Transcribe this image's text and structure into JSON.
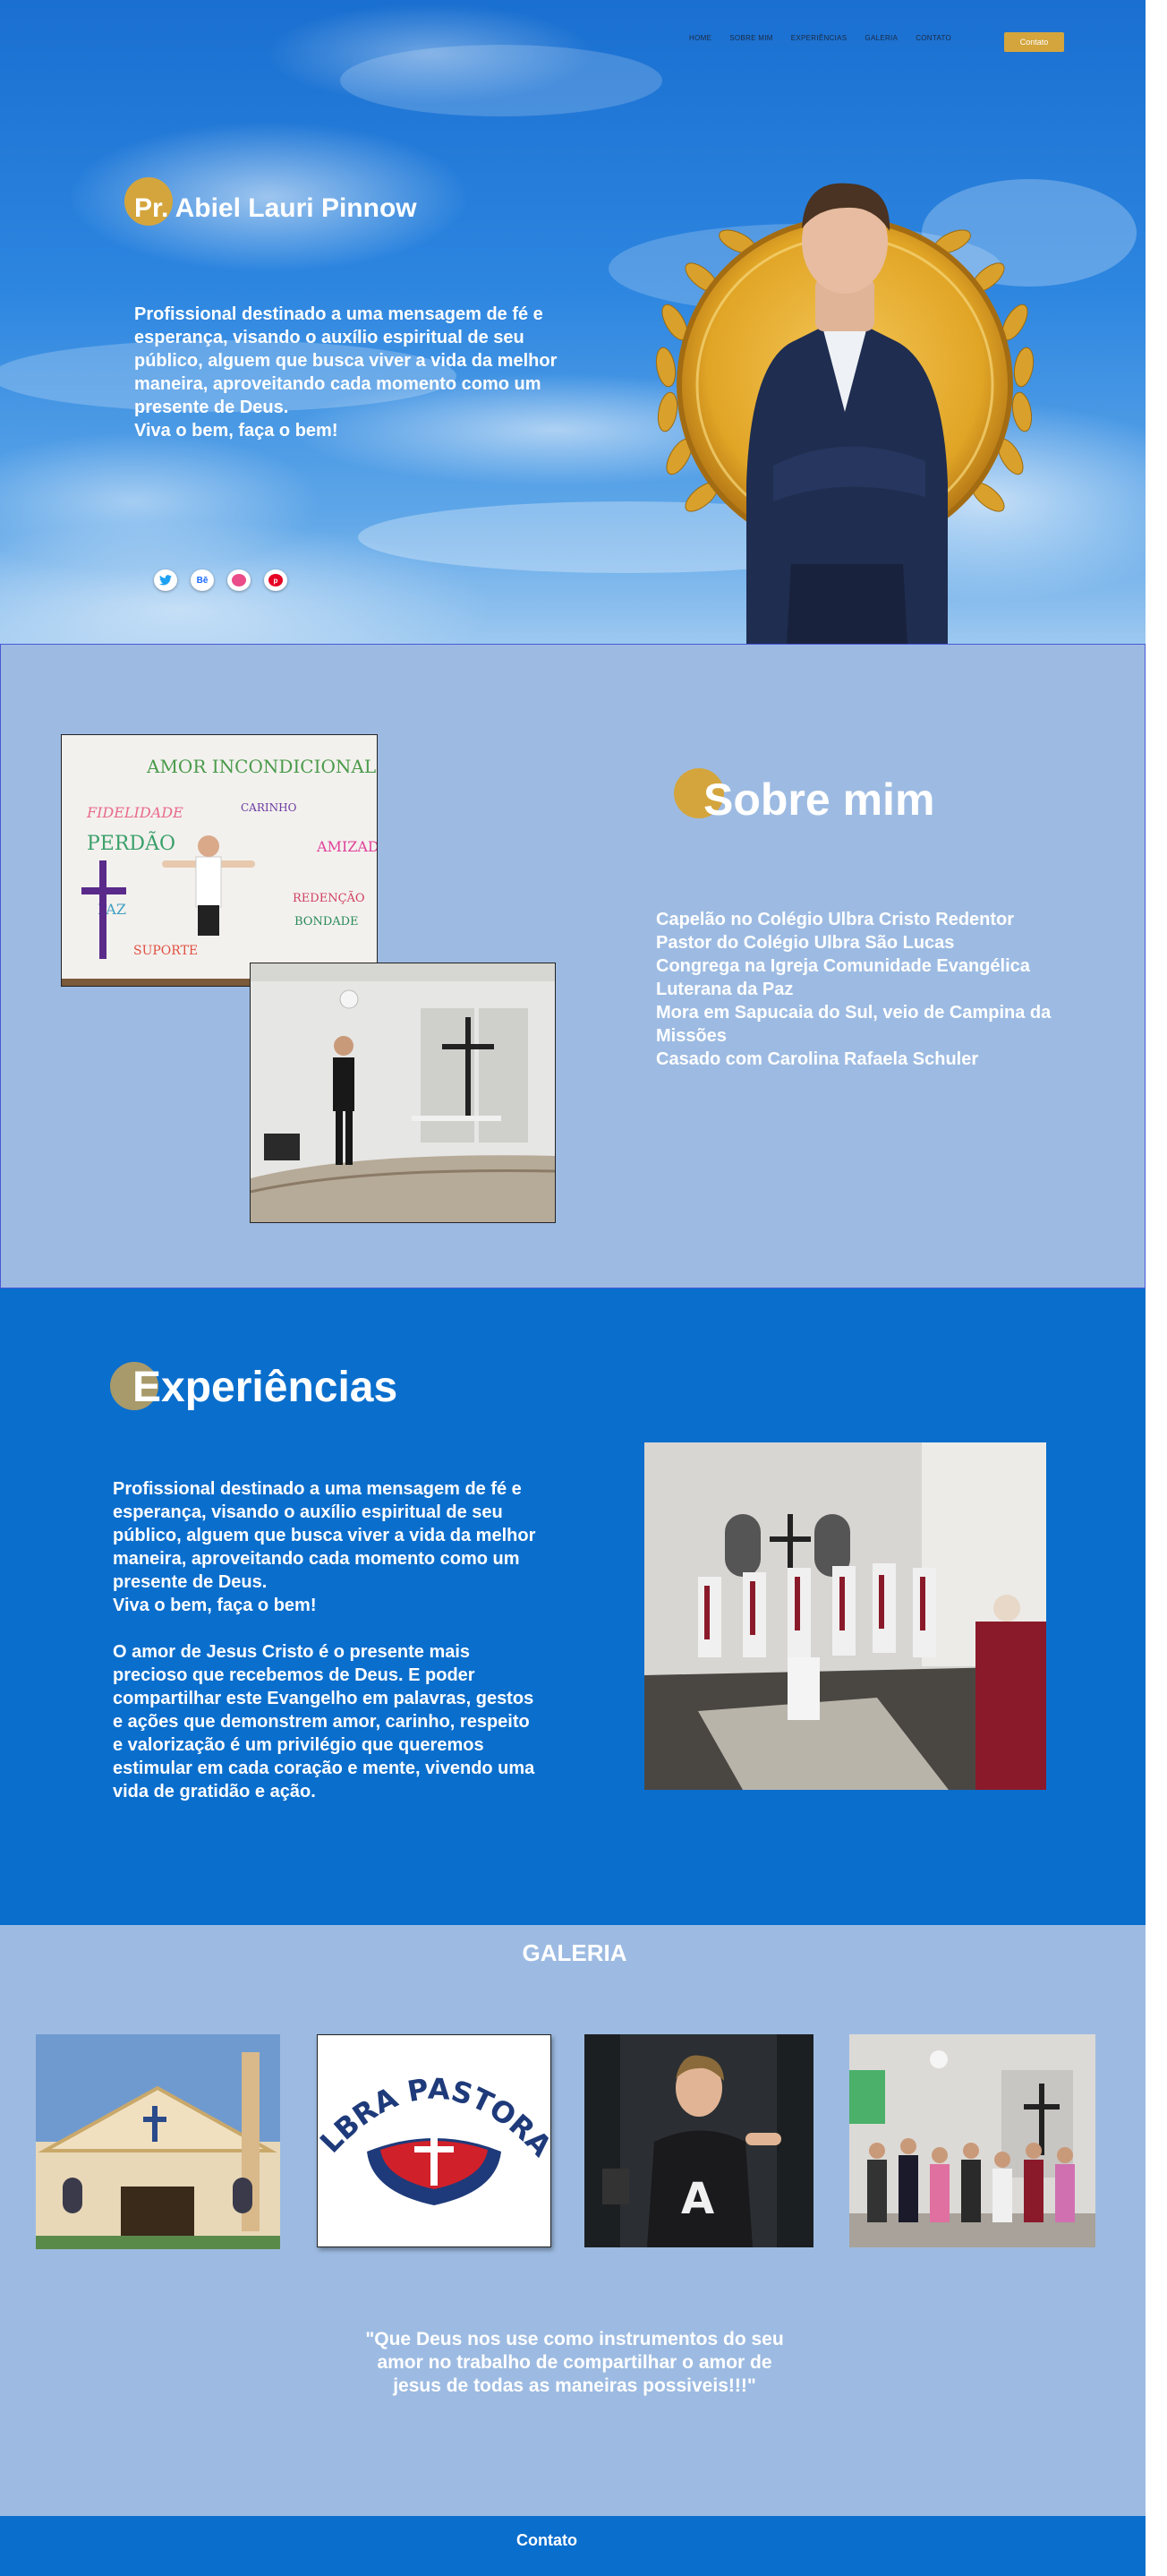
{
  "nav": {
    "links": [
      "HOME",
      "SOBRE MIM",
      "EXPERIÊNCIAS",
      "GALERIA",
      "CONTATO"
    ],
    "cta_label": "Contato"
  },
  "hero": {
    "title": "Pr. Abiel Lauri Pinnow",
    "text": "Profissional destinado a uma mensagem de fé e esperança, visando o auxílio espiritual de seu público, alguem que busca viver a vida da melhor maneira, aproveitando cada momento como um presente de Deus.\nViva o bem, faça o bem!",
    "socials": [
      "twitter-icon",
      "behance-icon",
      "dribbble-icon",
      "pinterest-icon"
    ]
  },
  "sobre": {
    "title": "Sobre mim",
    "items": [
      "Capelão no Colégio Ulbra Cristo Redentor",
      "Pastor do Colégio Ulbra São Lucas",
      "Congrega na Igreja Comunidade Evangélica Luterana da Paz",
      "Mora em Sapucaia do Sul, veio de Campina da Missões",
      "Casado com Carolina Rafaela Schuler"
    ],
    "mural_words": [
      "AMOR INCONDICIONAL",
      "FIDELIDADE",
      "PERDÃO",
      "CARINHO",
      "SUPORTE",
      "REDENÇÃO",
      "BONDADE",
      "AMIZADE",
      "PAZ"
    ]
  },
  "experiencias": {
    "title": "Experiências",
    "text": "Profissional destinado a uma mensagem de fé e esperança, visando o auxílio espiritual de seu público, alguem que busca viver a vida da melhor maneira, aproveitando cada momento como um presente de Deus.\nViva o bem, faça o bem!\n\nO amor de Jesus Cristo é o presente mais precioso que recebemos de Deus. E poder compartilhar este Evangelho em palavras, gestos e ações que demonstrem amor, carinho, respeito e valorização é um privilégio que queremos estimular em cada coração e mente, vivendo uma vida de gratidão e ação."
  },
  "galeria": {
    "title": "GALERIA",
    "logo_text": "ULBRA PASTORAL",
    "quote": "\"Que Deus nos use como instrumentos do seu amor no trabalho de compartilhar o amor de jesus de todas as maneiras possiveis!!!\""
  },
  "footer": {
    "label": "Contato"
  },
  "colors": {
    "accent": "#d4a53c",
    "section_blue": "#0a6ecd",
    "light_blue": "#9dbbe2"
  }
}
